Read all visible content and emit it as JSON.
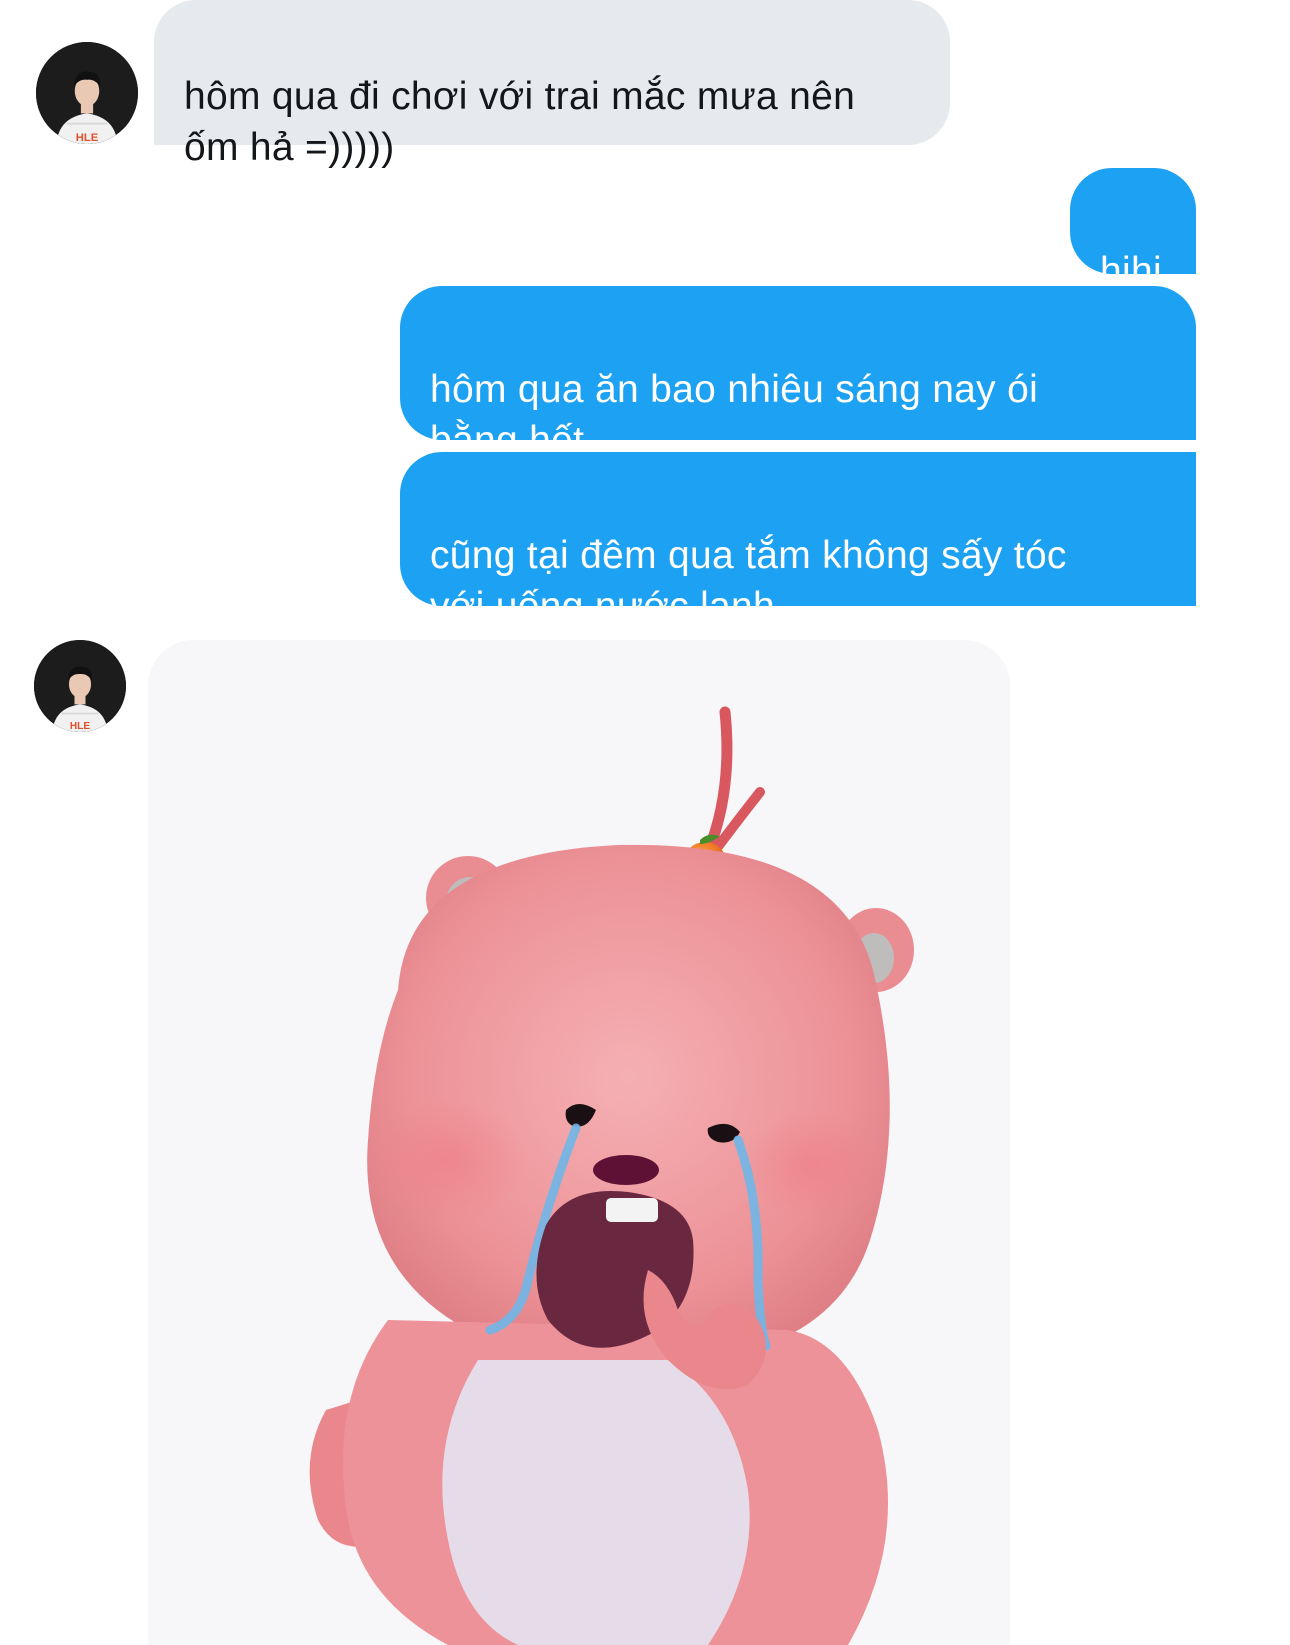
{
  "conversation": {
    "messages": [
      {
        "sender": "other",
        "type": "text",
        "text": "hôm qua đi chơi với trai mắc mưa nên\nốm hả =)))))"
      },
      {
        "sender": "me",
        "type": "text",
        "text": "hihi"
      },
      {
        "sender": "me",
        "type": "text",
        "text": "hôm qua ăn bao nhiêu sáng nay ói\nbằng hết"
      },
      {
        "sender": "me",
        "type": "text",
        "text": "cũng tại đêm qua tắm không sấy tóc\nvới uống nước lạnh"
      },
      {
        "sender": "other",
        "type": "sticker",
        "sticker_icon": "crying-pink-beaver-sticker"
      }
    ]
  },
  "avatar": {
    "jersey_text": "HLE"
  },
  "colors": {
    "incoming_bubble": "#e6e9ed",
    "outgoing_bubble": "#1da1f2",
    "incoming_text": "#14171a",
    "outgoing_text": "#ffffff"
  }
}
